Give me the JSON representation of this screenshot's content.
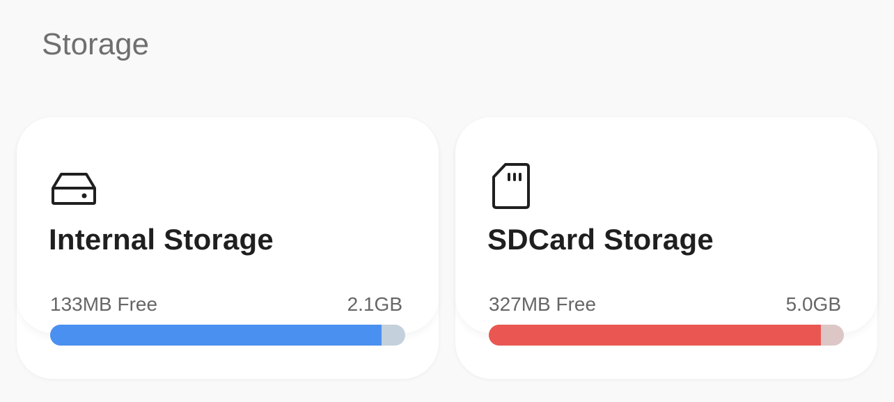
{
  "header": {
    "title": "Storage"
  },
  "cards": [
    {
      "key": "internal",
      "icon": "hard-drive-icon",
      "title": "Internal Storage",
      "free": "133MB Free",
      "total": "2.1GB",
      "used_fraction": 0.934,
      "fill_color": "#4a90f0",
      "track_color": "#c4d0dc"
    },
    {
      "key": "sdcard",
      "icon": "sd-card-icon",
      "title": "SDCard Storage",
      "free": "327MB Free",
      "total": "5.0GB",
      "used_fraction": 0.936,
      "fill_color": "#ea5752",
      "track_color": "#dcc6c6"
    }
  ]
}
